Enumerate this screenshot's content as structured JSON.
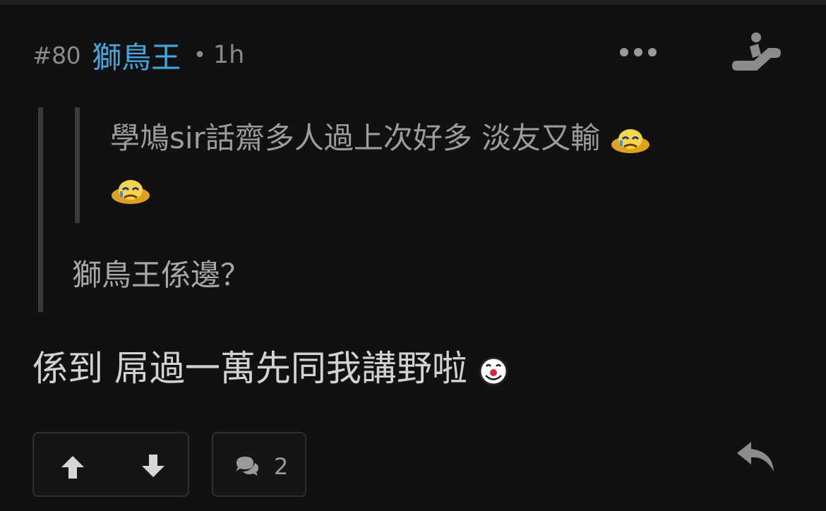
{
  "post": {
    "number": "#80",
    "username": "獅鳥王",
    "separator": "•",
    "time": "1h"
  },
  "quote": {
    "inner_text": "學鳩sir話齋多人過上次好多 淡友又輸",
    "outer_text": "獅鳥王係邊？"
  },
  "body_text": "係到 屌過一萬先同我講野啦",
  "comment_count": "2",
  "icons": {
    "more": "more-dots-icon",
    "escalator": "escalator-icon",
    "upvote": "arrow-up-icon",
    "downvote": "arrow-down-icon",
    "comment": "comment-bubble-icon",
    "reply": "reply-icon",
    "sad_emoji": "crying-emoji-icon",
    "clown_emoji": "clown-face-emoji-icon"
  },
  "colors": {
    "username": "#3fa9e6",
    "background": "#111112"
  }
}
